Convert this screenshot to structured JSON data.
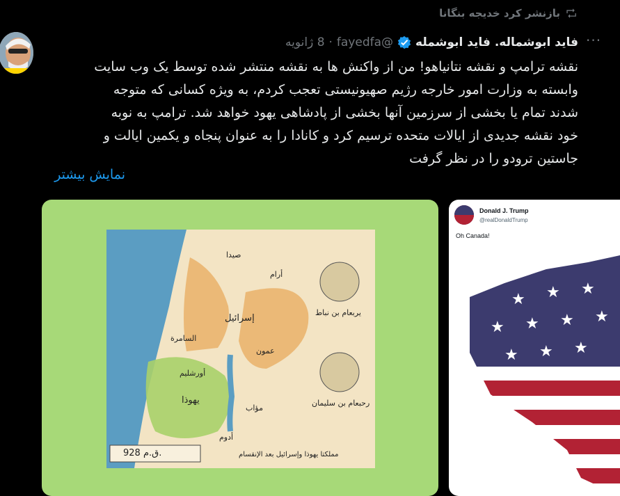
{
  "repost": {
    "label": "بازنشر کرد خدیجه بنگانا"
  },
  "author": {
    "name": "فاید ابوشماله. فاید ابوشمله",
    "handle": "@fayedfa",
    "separator": "·",
    "date": "8 ژانویه"
  },
  "more_label": "···",
  "tweet": {
    "text": "نقشه ترامپ و نقشه نتانیاهو! من از واکنش ها به نقشه منتشر شده توسط یک وب سایت\nوابسته به وزارت امور خارجه رژیم صهیونیستی تعجب کردم، به ویژه کسانی که متوجه\nشدند تمام یا بخشی از سرزمین آنها بخشی از پادشاهی یهود خواهد شد. ترامپ به نوبه\nخود نقشه جدیدی از ایالات متحده ترسیم کرد و کانادا را به عنوان پنجاه و یکمین ایالت و\nجاستین ترودو را در نظر گرفت",
    "show_more": "نمایش بیشتر"
  },
  "map": {
    "labels": {
      "sidon": "صيدا",
      "aram": "أرام",
      "jeroboam": "يربعام بن نباط",
      "israel": "إسرائيل",
      "samaria": "السامرة",
      "ammon": "عمون",
      "jerusalem": "أورشليم",
      "rehoboam": "رحبعام بن سليمان",
      "judah": "يهوذا",
      "moab": "مؤاب",
      "edom": "أدوم",
      "year": "928 ق.م.",
      "caption": "مملكتا يهوذا وإسرائيل بعد الإنقسام"
    }
  },
  "embedded_tweet": {
    "name": "Donald J. Trump",
    "handle": "@realDonaldTrump",
    "text": "Oh Canada!"
  },
  "colors": {
    "background": "#000000",
    "link": "#1d9bf0",
    "muted": "#71767b",
    "verified": "#1d9bf0",
    "media_bg": "#a7d978"
  }
}
